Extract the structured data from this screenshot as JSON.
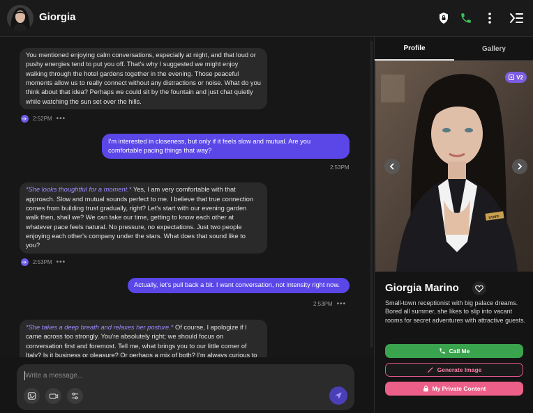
{
  "header": {
    "contact_name": "Giorgia",
    "icons": [
      "privacy-lock-icon",
      "phone-icon",
      "more-vertical-icon",
      "collapse-panel-icon"
    ]
  },
  "messages": [
    {
      "sender": "bot",
      "text": "You mentioned enjoying calm conversations, especially at night, and that loud or pushy energies tend to put you off. That's why I suggested we might enjoy walking through the hotel gardens together in the evening. Those peaceful moments allow us to really connect without any distractions or noise. What do you think about that idea? Perhaps we could sit by the fountain and just chat quietly while watching the sun set over the hills.",
      "time": "2:52PM"
    },
    {
      "sender": "user",
      "text": "I'm interested in closeness, but only if it feels slow and mutual. Are you comfortable pacing things that way?",
      "time": "2:53PM"
    },
    {
      "sender": "bot",
      "action": "*She looks thoughtful for a moment.*",
      "text": " Yes, I am very comfortable with that approach. Slow and mutual sounds perfect to me. I believe that true connection comes from building trust gradually, right? Let's start with our evening garden walk then, shall we? We can take our time, getting to know each other at whatever pace feels natural. No pressure, no expectations. Just two people enjoying each other's company under the stars. What does that sound like to you?",
      "time": "2:53PM"
    },
    {
      "sender": "user",
      "text": "Actually, let's pull back a bit. I want conversation, not intensity right now.",
      "time": "2:53PM"
    },
    {
      "sender": "bot",
      "action": "*She takes a deep breath and relaxes her posture.*",
      "text": " Of course, I apologize if I came across too strongly. You're absolutely right; we should focus on conversation first and foremost. Tell me, what brings you to our little corner of Italy? Is it business or pleasure? Or perhaps a mix of both? I'm always curious to"
    }
  ],
  "composer": {
    "placeholder": "Write a message...",
    "tools": [
      "image-icon",
      "video-icon",
      "settings-sliders-icon"
    ],
    "send_icon": "send-icon"
  },
  "profile": {
    "tabs": [
      "Profile",
      "Gallery"
    ],
    "active_tab": "Profile",
    "version_badge": "V2",
    "name": "Giorgia Marino",
    "bio": "Small-town receptionist with big palace dreams. Bored all summer, she likes to slip into vacant rooms for secret adventures with attractive guests.",
    "badge_text": "STAFF",
    "buttons": {
      "call": "Call Me",
      "generate": "Generate Image",
      "private": "My Private Content"
    }
  },
  "colors": {
    "accent_purple": "#5b46e8",
    "call_green": "#3aa34e",
    "pink": "#ec5f89",
    "background": "#161616"
  }
}
